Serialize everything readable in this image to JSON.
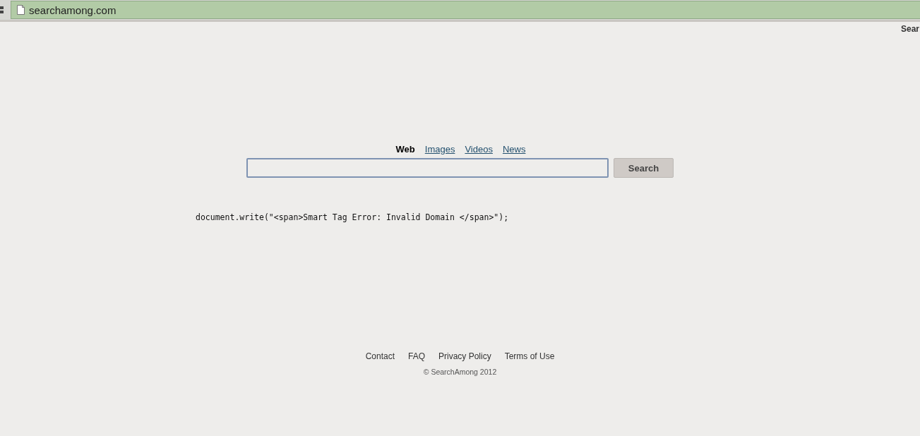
{
  "address_bar": {
    "url": "searchamong.com"
  },
  "corner_text": "Sear",
  "tabs": [
    {
      "label": "Web",
      "selected": true
    },
    {
      "label": "Images",
      "selected": false
    },
    {
      "label": "Videos",
      "selected": false
    },
    {
      "label": "News",
      "selected": false
    }
  ],
  "search": {
    "button": "Search"
  },
  "code_text": "document.write(\"<span>Smart Tag Error: Invalid Domain </span>\");",
  "footer": {
    "links": [
      "Contact",
      "FAQ",
      "Privacy Policy",
      "Terms of Use"
    ],
    "copyright": "© SearchAmong 2012"
  }
}
